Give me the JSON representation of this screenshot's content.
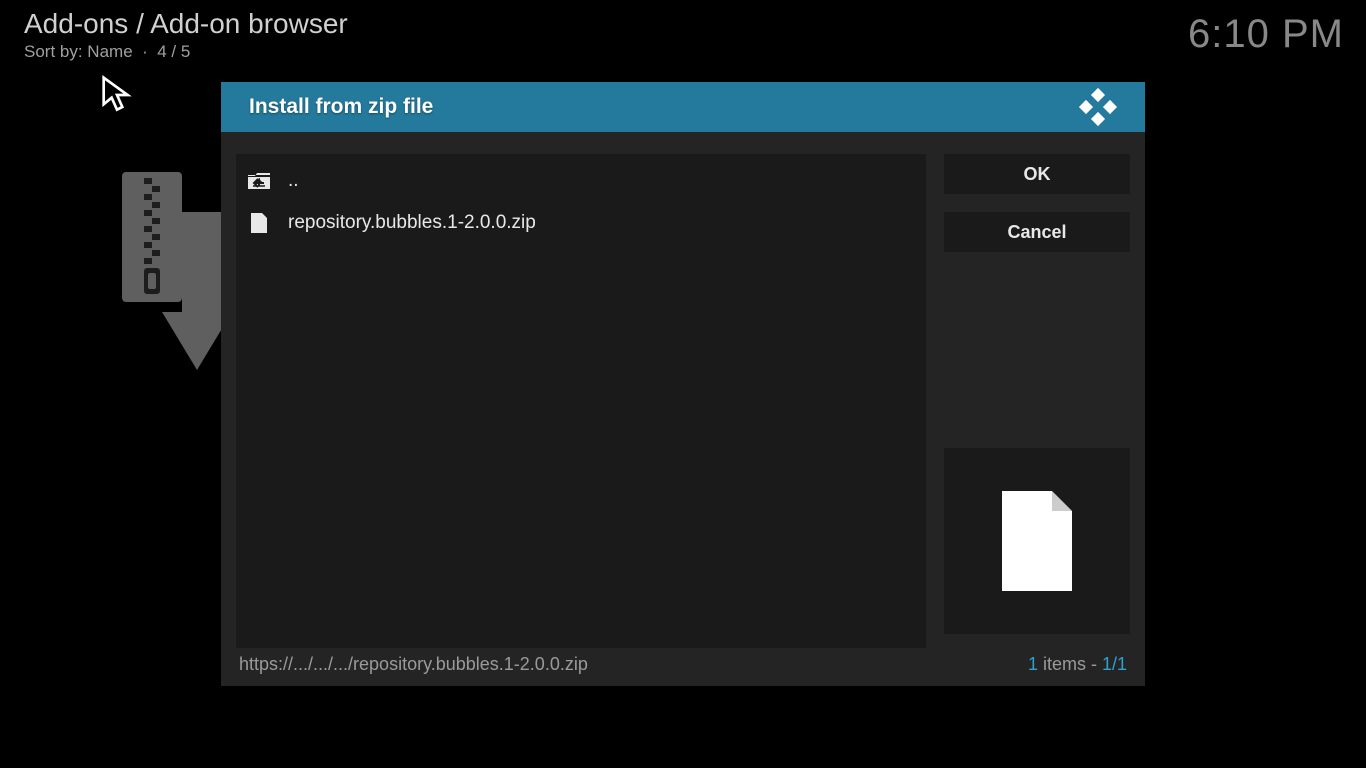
{
  "header": {
    "title": "Add-ons / Add-on browser",
    "sort_label": "Sort by: Name",
    "position": "4 / 5"
  },
  "clock": "6:10 PM",
  "dialog": {
    "title": "Install from zip file",
    "files": {
      "up_label": "..",
      "item1_label": "repository.bubbles.1-2.0.0.zip"
    },
    "actions": {
      "ok": "OK",
      "cancel": "Cancel"
    },
    "footer": {
      "path": "https://.../.../.../repository.bubbles.1-2.0.0.zip",
      "count_num": "1",
      "count_label": " items - ",
      "index": "1/1"
    }
  }
}
